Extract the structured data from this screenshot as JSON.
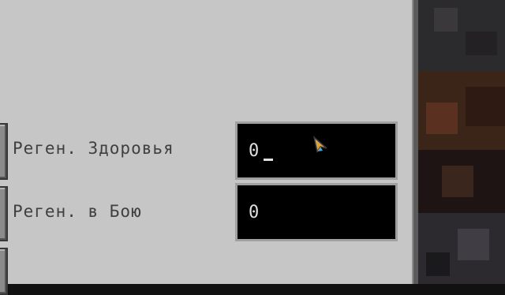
{
  "rows": [
    {
      "label": "Реген. Здоровья",
      "value": "0",
      "focused": true,
      "icon": "slot-button"
    },
    {
      "label": "Реген. в Бою",
      "value": "0",
      "focused": false,
      "icon": "slot-button"
    }
  ],
  "colors": {
    "panel_bg": "#c6c6c6",
    "label_text": "#404040",
    "field_bg": "#000000",
    "field_border": "#a0a0a0",
    "field_text": "#e0e0e0"
  },
  "cursor": {
    "icon": "mouse-pointer-icon"
  }
}
